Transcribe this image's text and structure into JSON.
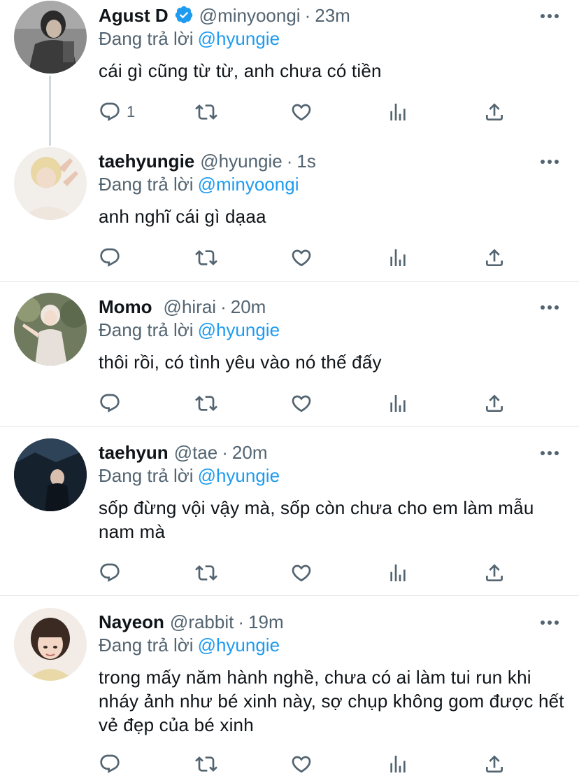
{
  "reply_prefix": "Đang trả lời",
  "tweets": [
    {
      "name": "Agust D",
      "verified": true,
      "handle": "@minyoongi",
      "separator": "·",
      "time": "23m",
      "reply_to": "@hyungie",
      "text": "cái gì cũng từ từ, anh chưa có tiền",
      "reply_count": "1",
      "avatar": "avatar-photo-dark-jacket"
    },
    {
      "name": "taehyungie",
      "verified": false,
      "handle": "@hyungie",
      "separator": "·",
      "time": "1s",
      "reply_to": "@minyoongi",
      "text": "anh nghĩ cái gì dạaa",
      "reply_count": "",
      "avatar": "avatar-photo-peace-sign"
    },
    {
      "name": "Momo",
      "verified": false,
      "handle": "@hirai",
      "separator": "·",
      "time": "20m",
      "reply_to": "@hyungie",
      "text": "thôi rồi, có tình yêu vào nó thế đấy",
      "reply_count": "",
      "avatar": "avatar-photo-garden"
    },
    {
      "name": "taehyun",
      "verified": false,
      "handle": "@tae",
      "separator": "·",
      "time": "20m",
      "reply_to": "@hyungie",
      "text": "sốp đừng vội vậy mà, sốp còn chưa cho em làm mẫu nam mà",
      "reply_count": "",
      "avatar": "avatar-photo-dark-building"
    },
    {
      "name": "Nayeon",
      "verified": false,
      "handle": "@rabbit",
      "separator": "·",
      "time": "19m",
      "reply_to": "@hyungie",
      "text": "trong mấy năm hành nghề, chưa có ai làm tui run khi nháy ảnh như bé xinh này, sợ chụp không gom được hết vẻ đẹp của bé xinh",
      "reply_count": "",
      "avatar": "avatar-photo-bangs"
    }
  ],
  "icons": {
    "reply": "reply-icon",
    "retweet": "retweet-icon",
    "like": "like-icon",
    "views": "views-icon",
    "share": "share-icon",
    "more": "more-icon",
    "verified": "verified-badge-icon"
  },
  "colors": {
    "link": "#1d9bf0",
    "secondary_text": "#536471",
    "primary_text": "#0f1419",
    "divider": "#e1e6ea"
  }
}
